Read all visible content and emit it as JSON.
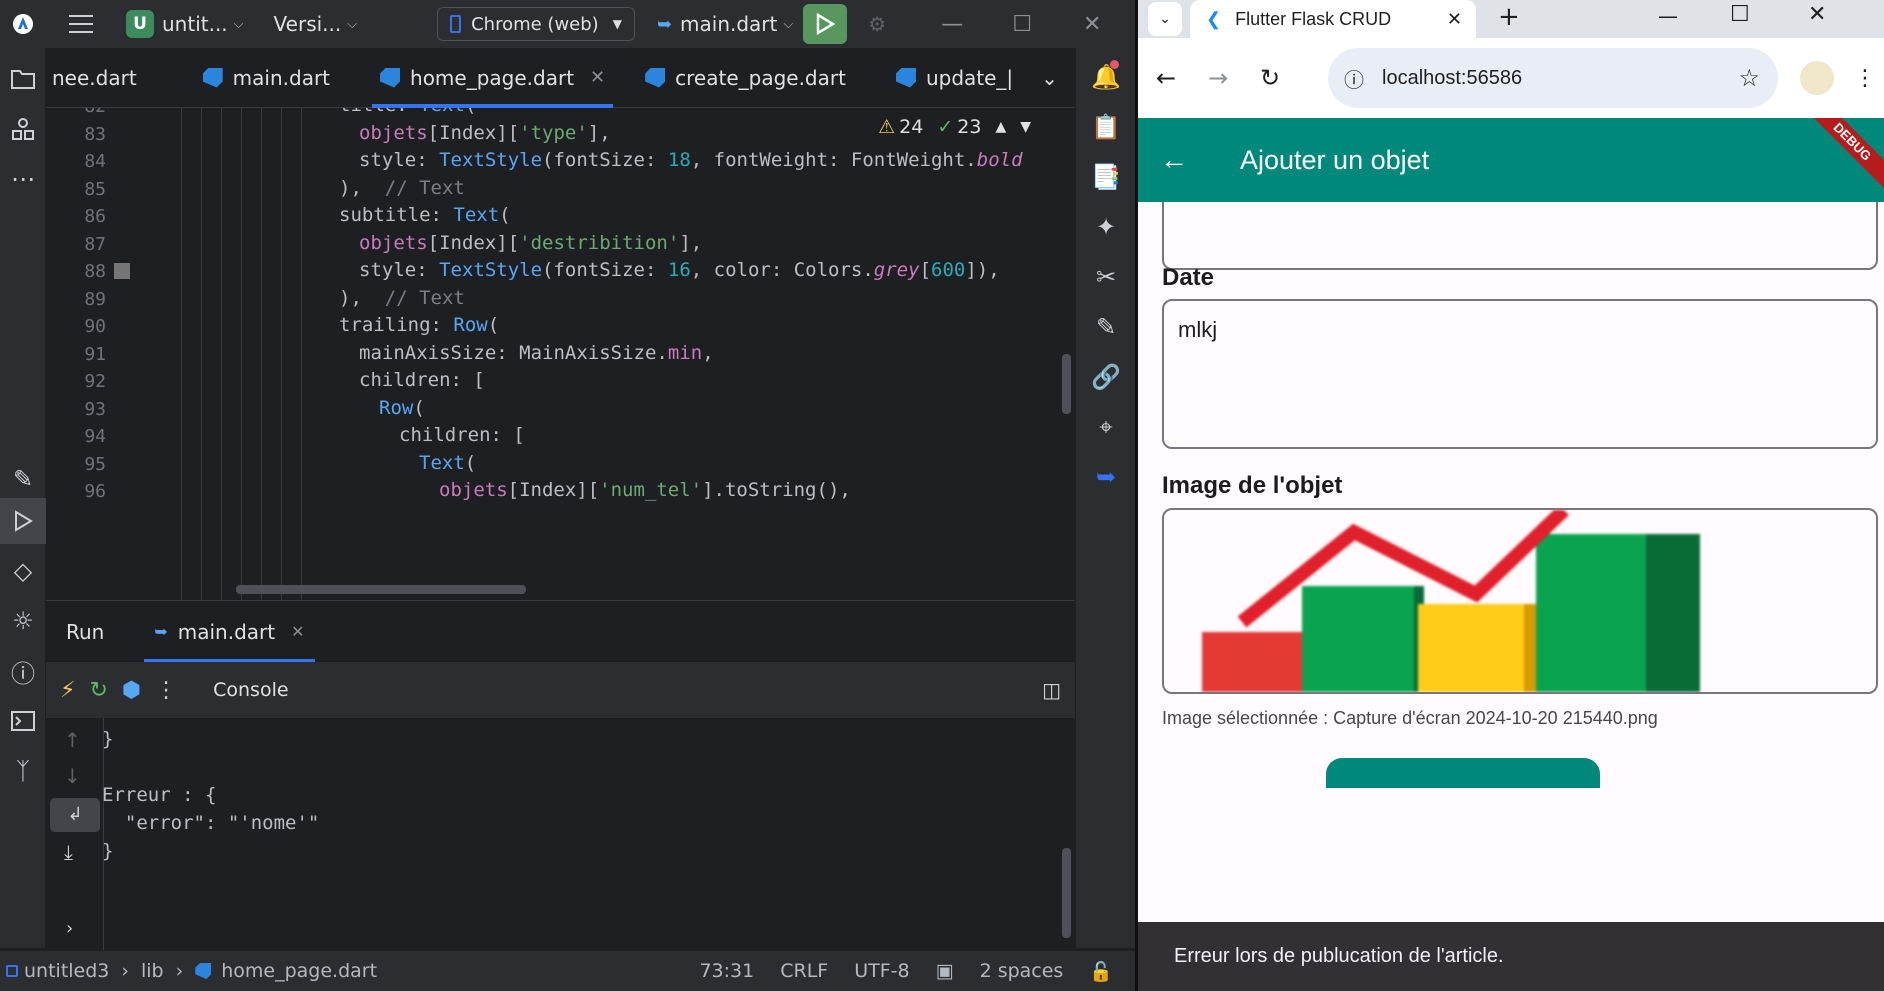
{
  "ide": {
    "project_badge": "U",
    "project_name": "untit...",
    "vcs_label": "Versi...",
    "device": "Chrome (web)",
    "run_config": "main.dart",
    "editor_tabs": [
      {
        "label": "nee.dart"
      },
      {
        "label": "main.dart"
      },
      {
        "label": "home_page.dart",
        "active": true
      },
      {
        "label": "create_page.dart"
      },
      {
        "label": "update_|"
      }
    ],
    "inspections": {
      "warnings": "24",
      "ok": "23"
    },
    "line_numbers": [
      "82",
      "83",
      "84",
      "85",
      "86",
      "87",
      "88",
      "89",
      "90",
      "91",
      "92",
      "93",
      "94",
      "95",
      "96"
    ],
    "run_label": "Run",
    "run_tab": "main.dart",
    "console_label": "Console",
    "console_lines": [
      "}",
      "",
      "Erreur : {",
      "  \"error\": \"'nome'\"",
      "}"
    ],
    "status": {
      "project": "untitled3",
      "folder": "lib",
      "file": "home_page.dart",
      "position": "73:31",
      "line_ending": "CRLF",
      "encoding": "UTF-8",
      "indent": "2 spaces"
    }
  },
  "browser": {
    "tab_title": "Flutter Flask CRUD",
    "url": "localhost:56586",
    "accent": "#00897b",
    "app_title": "Ajouter un objet",
    "debug_banner": "DEBUG",
    "date_label": "Date",
    "date_value": "mlkj",
    "image_label": "Image de l'objet",
    "selected_image": "Image sélectionnée : Capture d'écran 2024-10-20 215440.png",
    "snackbar": "Erreur lors de publucation de l'article."
  }
}
